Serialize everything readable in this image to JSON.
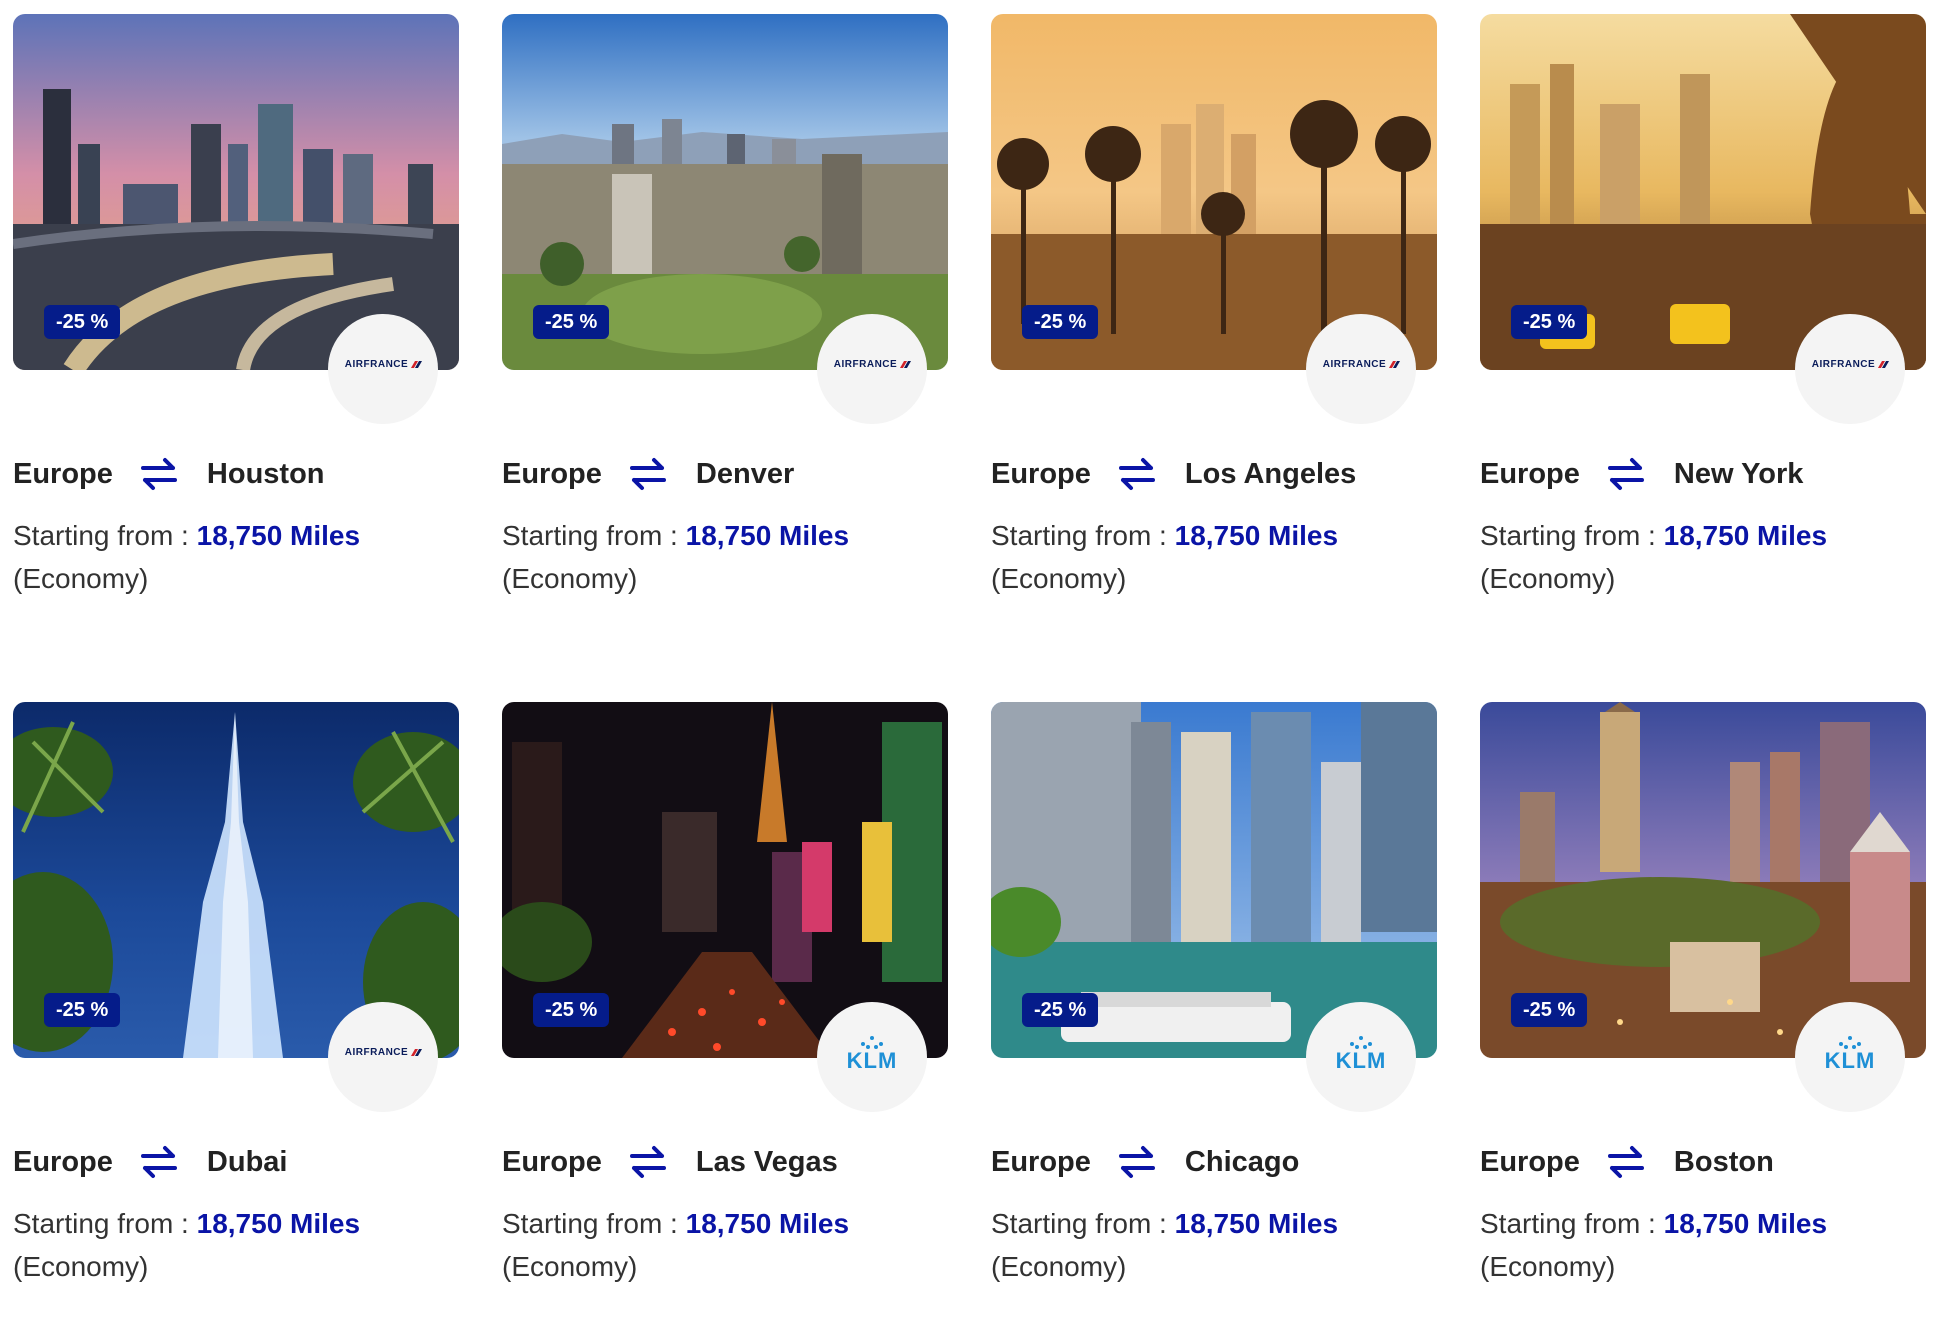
{
  "cards": [
    {
      "origin": "Europe",
      "destination": "Houston",
      "discount": "-25 %",
      "airline": "AIRFRANCE",
      "label": "Starting from :",
      "miles": "18,750 Miles",
      "cabin": "(Economy)"
    },
    {
      "origin": "Europe",
      "destination": "Denver",
      "discount": "-25 %",
      "airline": "AIRFRANCE",
      "label": "Starting from :",
      "miles": "18,750 Miles",
      "cabin": "(Economy)"
    },
    {
      "origin": "Europe",
      "destination": "Los Angeles",
      "discount": "-25 %",
      "airline": "AIRFRANCE",
      "label": "Starting from :",
      "miles": "18,750 Miles",
      "cabin": "(Economy)"
    },
    {
      "origin": "Europe",
      "destination": "New York",
      "discount": "-25 %",
      "airline": "AIRFRANCE",
      "label": "Starting from :",
      "miles": "18,750 Miles",
      "cabin": "(Economy)"
    },
    {
      "origin": "Europe",
      "destination": "Dubai",
      "discount": "-25 %",
      "airline": "AIRFRANCE",
      "label": "Starting from :",
      "miles": "18,750 Miles",
      "cabin": "(Economy)"
    },
    {
      "origin": "Europe",
      "destination": "Las Vegas",
      "discount": "-25 %",
      "airline": "KLM",
      "label": "Starting from :",
      "miles": "18,750 Miles",
      "cabin": "(Economy)"
    },
    {
      "origin": "Europe",
      "destination": "Chicago",
      "discount": "-25 %",
      "airline": "KLM",
      "label": "Starting from :",
      "miles": "18,750 Miles",
      "cabin": "(Economy)"
    },
    {
      "origin": "Europe",
      "destination": "Boston",
      "discount": "-25 %",
      "airline": "KLM",
      "label": "Starting from :",
      "miles": "18,750 Miles",
      "cabin": "(Economy)"
    }
  ],
  "colors": {
    "badge": "#051c8a",
    "miles": "#0a14a6",
    "arrows": "#0a14a6",
    "klm": "#1e90d6",
    "airfrance_red": "#d2232a"
  },
  "icons": {
    "route": "swap-arrows-icon"
  }
}
